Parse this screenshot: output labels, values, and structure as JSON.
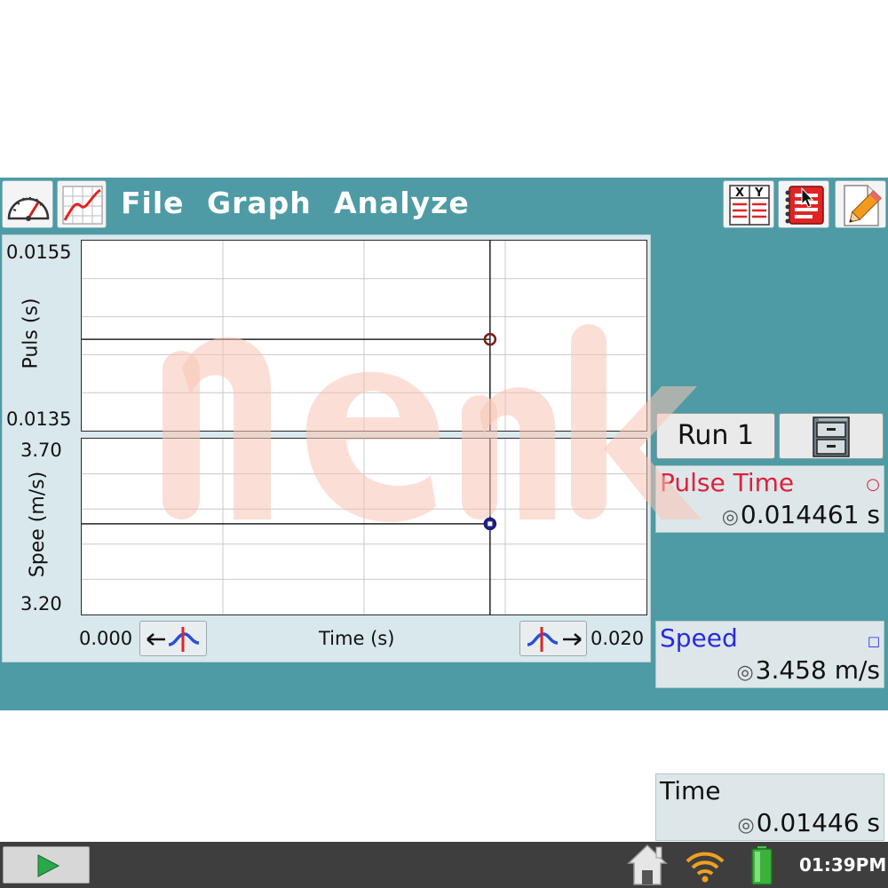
{
  "menu": {
    "file": "File",
    "graph": "Graph",
    "analyze": "Analyze"
  },
  "toolbar": {
    "meter_icon": "gauge-icon",
    "graph_icon": "graph-icon",
    "table_icon": "table-xy-icon",
    "table_x": "X",
    "table_y": "Y",
    "notes_icon": "notebook-icon",
    "edit_icon": "pencil-icon"
  },
  "graph": {
    "top_plot": {
      "ymax": "0.0155",
      "ymin": "0.0135",
      "ylabel": "Puls (s)"
    },
    "bottom_plot": {
      "ymax": "3.70",
      "ymin": "3.20",
      "ylabel": "Spee (m/s)"
    },
    "xmin": "0.000",
    "xmax": "0.020",
    "xlabel": "Time (s)"
  },
  "side": {
    "run_label": "Run 1",
    "cabinet_icon": "file-cabinet-icon"
  },
  "meters": [
    {
      "name": "Pulse Time",
      "value": "0.014461 s",
      "mark": "○",
      "color": "#e0203a"
    },
    {
      "name": "Speed",
      "value": "3.458 m/s",
      "mark": "□",
      "color": "#2a2ae0"
    },
    {
      "name": "Time",
      "value": "0.01446 s",
      "mark": "",
      "color": "#111111"
    }
  ],
  "taskbar": {
    "clock": "01:39PM"
  },
  "chart_data": [
    {
      "type": "line",
      "title": "",
      "xlabel": "Time (s)",
      "ylabel": "Puls (s)",
      "xlim": [
        0.0,
        0.02
      ],
      "ylim": [
        0.0135,
        0.0155
      ],
      "grid": true,
      "series": [
        {
          "x": [
            0.0,
            0.01446
          ],
          "y": [
            0.014461,
            0.014461
          ]
        }
      ],
      "cursor_x": 0.01446
    },
    {
      "type": "line",
      "title": "",
      "xlabel": "Time (s)",
      "ylabel": "Spee (m/s)",
      "xlim": [
        0.0,
        0.02
      ],
      "ylim": [
        3.2,
        3.7
      ],
      "grid": true,
      "series": [
        {
          "x": [
            0.0,
            0.01446
          ],
          "y": [
            3.458,
            3.458
          ]
        }
      ],
      "cursor_x": 0.01446
    }
  ]
}
